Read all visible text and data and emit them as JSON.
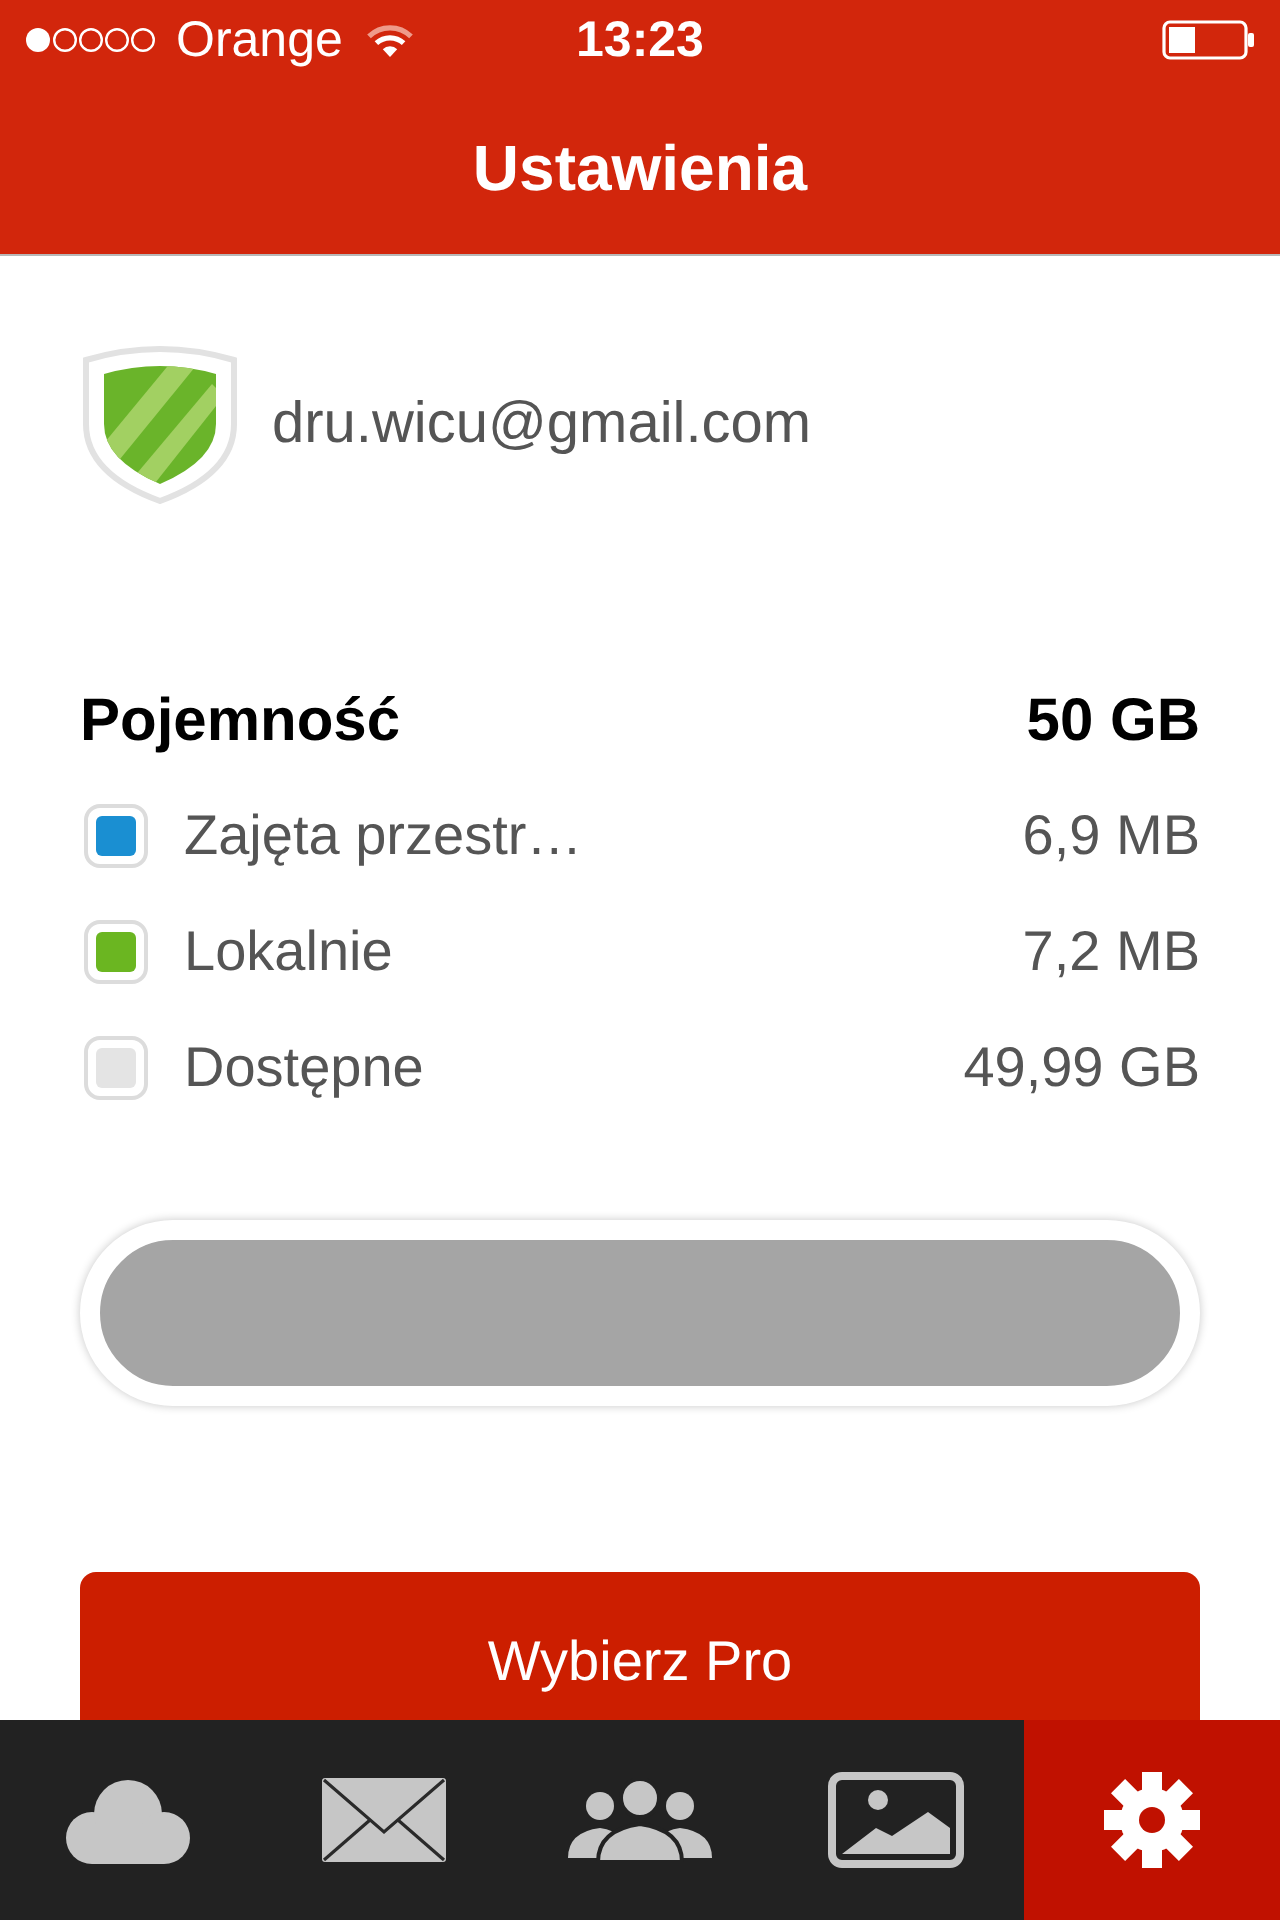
{
  "status_bar": {
    "carrier": "Orange",
    "time": "13:23"
  },
  "header": {
    "title": "Ustawienia"
  },
  "account": {
    "email": "dru.wicu@gmail.com"
  },
  "storage": {
    "title": "Pojemność",
    "total": "50 GB",
    "items": [
      {
        "label": "Zajęta przestr…",
        "value": "6,9 MB",
        "color": "#1a8fd2"
      },
      {
        "label": "Lokalnie",
        "value": "7,2 MB",
        "color": "#6bb621"
      },
      {
        "label": "Dostępne",
        "value": "49,99 GB",
        "color": "#e4e4e4"
      }
    ]
  },
  "upgrade_button": {
    "label": "Wybierz Pro"
  },
  "tab_bar": {
    "tabs": [
      {
        "kind": "cloud",
        "selected": false
      },
      {
        "kind": "mail",
        "selected": false
      },
      {
        "kind": "people",
        "selected": false
      },
      {
        "kind": "photos",
        "selected": false
      },
      {
        "kind": "settings",
        "selected": true
      }
    ]
  }
}
